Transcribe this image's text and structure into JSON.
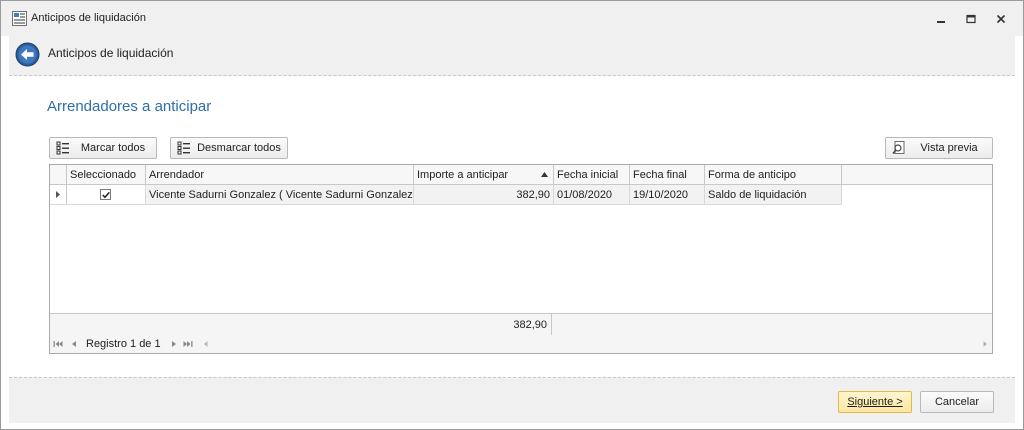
{
  "window": {
    "title": "Anticipos de liquidación"
  },
  "header": {
    "title": "Anticipos de liquidación"
  },
  "section": {
    "title": "Arrendadores a anticipar"
  },
  "toolbar": {
    "mark_all_label": "Marcar todos",
    "unmark_all_label": "Desmarcar todos",
    "preview_label": "Vista previa"
  },
  "grid": {
    "columns": [
      "Seleccionado",
      "Arrendador",
      "Importe a anticipar",
      "Fecha inicial",
      "Fecha final",
      "Forma de anticipo"
    ],
    "sorted_column": "Importe a anticipar",
    "sort_direction": "ascending",
    "rows": [
      {
        "selected": true,
        "arrendador": "Vicente Sadurni Gonzalez ( Vicente Sadurni Gonzalez )",
        "importe": "382,90",
        "fecha_inicial": "01/08/2020",
        "fecha_final": "19/10/2020",
        "forma": "Saldo de liquidación"
      }
    ],
    "footer_total": "382,90",
    "navigator_text": "Registro 1 de 1"
  },
  "actions": {
    "next_label": "Siguiente >",
    "cancel_label": "Cancelar"
  },
  "colors": {
    "accent": "#2e6fa8",
    "default_button": "#fbe6a2"
  },
  "icons": {
    "back": "back-arrow-icon",
    "mark_all": "list-check-icon",
    "unmark_all": "list-uncheck-icon",
    "preview": "magnifier-page-icon"
  }
}
